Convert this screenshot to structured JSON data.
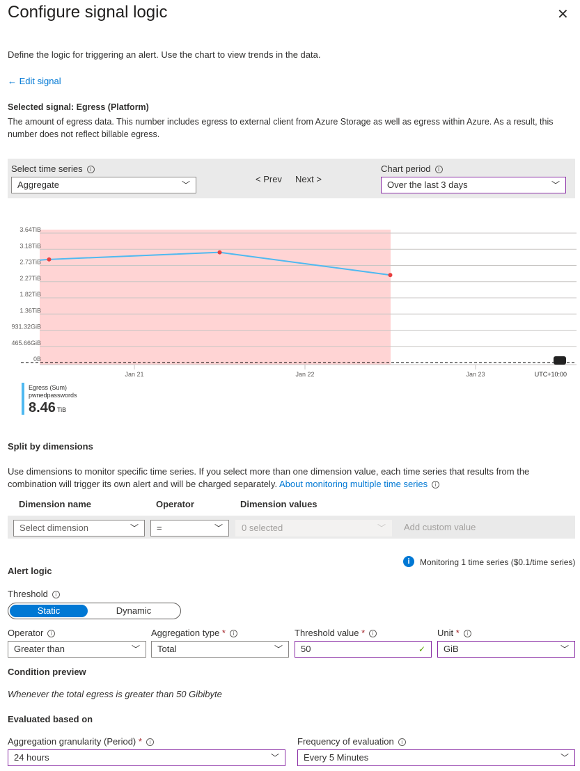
{
  "title": "Configure signal logic",
  "close_icon": "close-icon",
  "description": "Define the logic for triggering an alert. Use the chart to view trends in the data.",
  "edit_signal": "← Edit signal",
  "signal": {
    "heading": "Selected signal: Egress (Platform)",
    "description": "The amount of egress data. This number includes egress to external client from Azure Storage as well as egress within Azure. As a result, this number does not reflect billable egress."
  },
  "chart_controls": {
    "time_series_label": "Select time series",
    "time_series_value": "Aggregate",
    "prev": "< Prev",
    "next": "Next >",
    "period_label": "Chart period",
    "period_value": "Over the last 3 days"
  },
  "chart_data": {
    "type": "line",
    "y_ticks": [
      "3.64TiB",
      "3.18TiB",
      "2.73TiB",
      "2.27TiB",
      "1.82TiB",
      "1.36TiB",
      "931.32GiB",
      "465.66GiB",
      "0B"
    ],
    "x_ticks": [
      "Jan 21",
      "Jan 22",
      "Jan 23"
    ],
    "timezone": "UTC+10:00",
    "ylim_tib": [
      0,
      3.64
    ],
    "x": [
      "Jan 20 12:00",
      "Jan 21 12:00",
      "Jan 22 12:00"
    ],
    "series": [
      {
        "name": "Egress (Sum)",
        "values_tib": [
          2.9,
          3.1,
          2.46
        ],
        "color": "#4fb9f0",
        "marker_color": "#e83f3f"
      }
    ],
    "threshold_line": "0B",
    "highlight_color": "#ffd4d4",
    "grid": true,
    "legend": {
      "metric": "Egress (Sum)",
      "resource": "pwnedpasswords",
      "value": "8.46",
      "unit": "TiB"
    }
  },
  "split": {
    "heading": "Split by dimensions",
    "description": "Use dimensions to monitor specific time series. If you select more than one dimension value, each time series that results from the combination will trigger its own alert and will be charged separately.",
    "link": "About monitoring multiple time series",
    "col_name": "Dimension name",
    "col_operator": "Operator",
    "col_values": "Dimension values",
    "name_placeholder": "Select dimension",
    "operator_value": "=",
    "values_placeholder": "0 selected",
    "custom_placeholder": "Add custom value"
  },
  "monitoring_note": "Monitoring 1 time series ($0.1/time series)",
  "alert": {
    "heading": "Alert logic",
    "threshold_label": "Threshold",
    "static": "Static",
    "dynamic": "Dynamic",
    "operator_label": "Operator",
    "operator_value": "Greater than",
    "agg_label": "Aggregation type",
    "agg_value": "Total",
    "threshold_value_label": "Threshold value",
    "threshold_value": "50",
    "unit_label": "Unit",
    "unit_value": "GiB",
    "req": "*"
  },
  "preview": {
    "heading": "Condition preview",
    "text": "Whenever the total egress is greater than 50 Gibibyte"
  },
  "evaluated": {
    "heading": "Evaluated based on",
    "granularity_label": "Aggregation granularity (Period)",
    "granularity_value": "24 hours",
    "frequency_label": "Frequency of evaluation",
    "frequency_value": "Every 5 Minutes"
  }
}
